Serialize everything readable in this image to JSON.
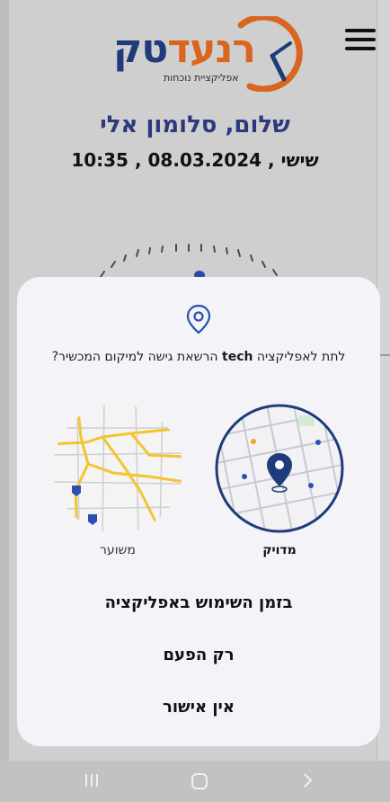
{
  "header": {
    "logo_main_orange": "רנעד",
    "logo_main_blue": "טק",
    "logo_sub": "אפליקציית נוכחות",
    "menu_icon": "hamburger-icon"
  },
  "greeting": "שלום, סלומון אלי",
  "datetime": "שישי , 08.03.2024 , 10:35",
  "permission": {
    "icon": "location-pin-icon",
    "question_pre": "לתת לאפליקציה ",
    "question_app": "tech",
    "question_post": " הרשאת גישה למיקום המכשיר?",
    "precise_label": "מדויק",
    "approx_label": "משוער",
    "btn_while_using": "בזמן השימוש באפליקציה",
    "btn_only_once": "רק הפעם",
    "btn_deny": "אין אישור"
  },
  "colors": {
    "brand_orange": "#d9651e",
    "brand_blue": "#1f3b7a",
    "sheet_bg": "#f3f3f8",
    "accent_blue": "#2a51b0"
  },
  "navbar": {
    "recents_icon": "recents-icon",
    "home_icon": "home-icon",
    "back_icon": "back-icon"
  }
}
